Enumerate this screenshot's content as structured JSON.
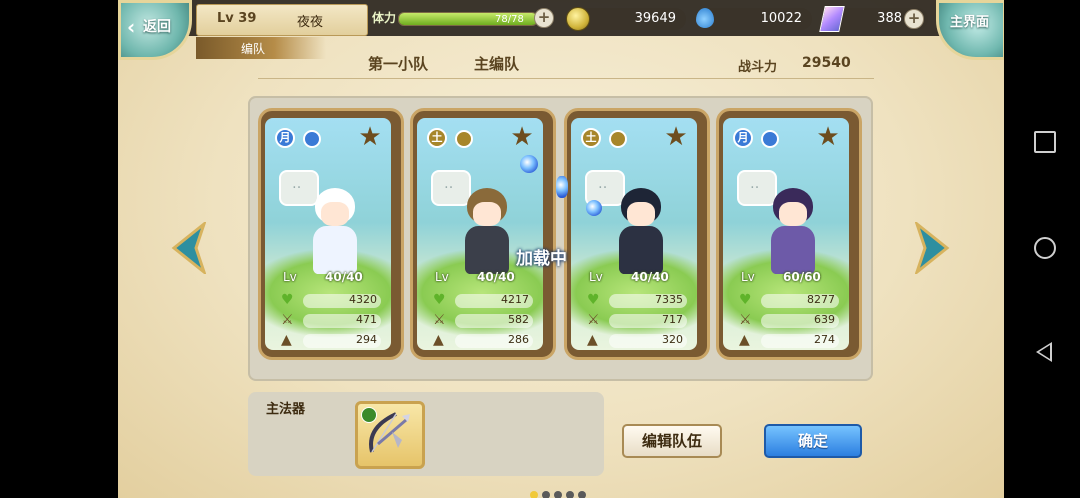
{
  "topbar": {
    "back_label": "返回",
    "level": "Lv 39",
    "player_name": "夜夜",
    "stamina_label": "体力",
    "stamina_value": "78/78",
    "stamina_fraction": 1.0,
    "gold": "39649",
    "water": "10022",
    "crystal": "388",
    "home_label": "主界面",
    "section_tag": "编队"
  },
  "header": {
    "team_name": "第一小队",
    "team_type": "主编队",
    "power_label": "战斗力",
    "power_value": "29540"
  },
  "cards": [
    {
      "elem": "月",
      "elem_color": "#3a7ad6",
      "lv_label": "Lv",
      "level": "40/40",
      "hp": "4320",
      "atk": "471",
      "def": "294",
      "hair_color": "#ffffff",
      "body_color": "#eef4ff"
    },
    {
      "elem": "土",
      "elem_color": "#a7862a",
      "lv_label": "Lv",
      "level": "40/40",
      "hp": "4217",
      "atk": "582",
      "def": "286",
      "hair_color": "#8a6a3a",
      "body_color": "#3b3f4a"
    },
    {
      "elem": "土",
      "elem_color": "#a7862a",
      "lv_label": "Lv",
      "level": "40/40",
      "hp": "7335",
      "atk": "717",
      "def": "320",
      "hair_color": "#1e2536",
      "body_color": "#2c3142"
    },
    {
      "elem": "月",
      "elem_color": "#3a7ad6",
      "lv_label": "Lv",
      "level": "60/60",
      "hp": "8277",
      "atk": "639",
      "def": "274",
      "hair_color": "#3a2a5a",
      "body_color": "#6d5aa8"
    }
  ],
  "loading_text": "加载中",
  "weapon": {
    "label": "主法器"
  },
  "buttons": {
    "edit": "编辑队伍",
    "confirm": "确定"
  },
  "pagination": {
    "count": 5,
    "active": 0
  }
}
